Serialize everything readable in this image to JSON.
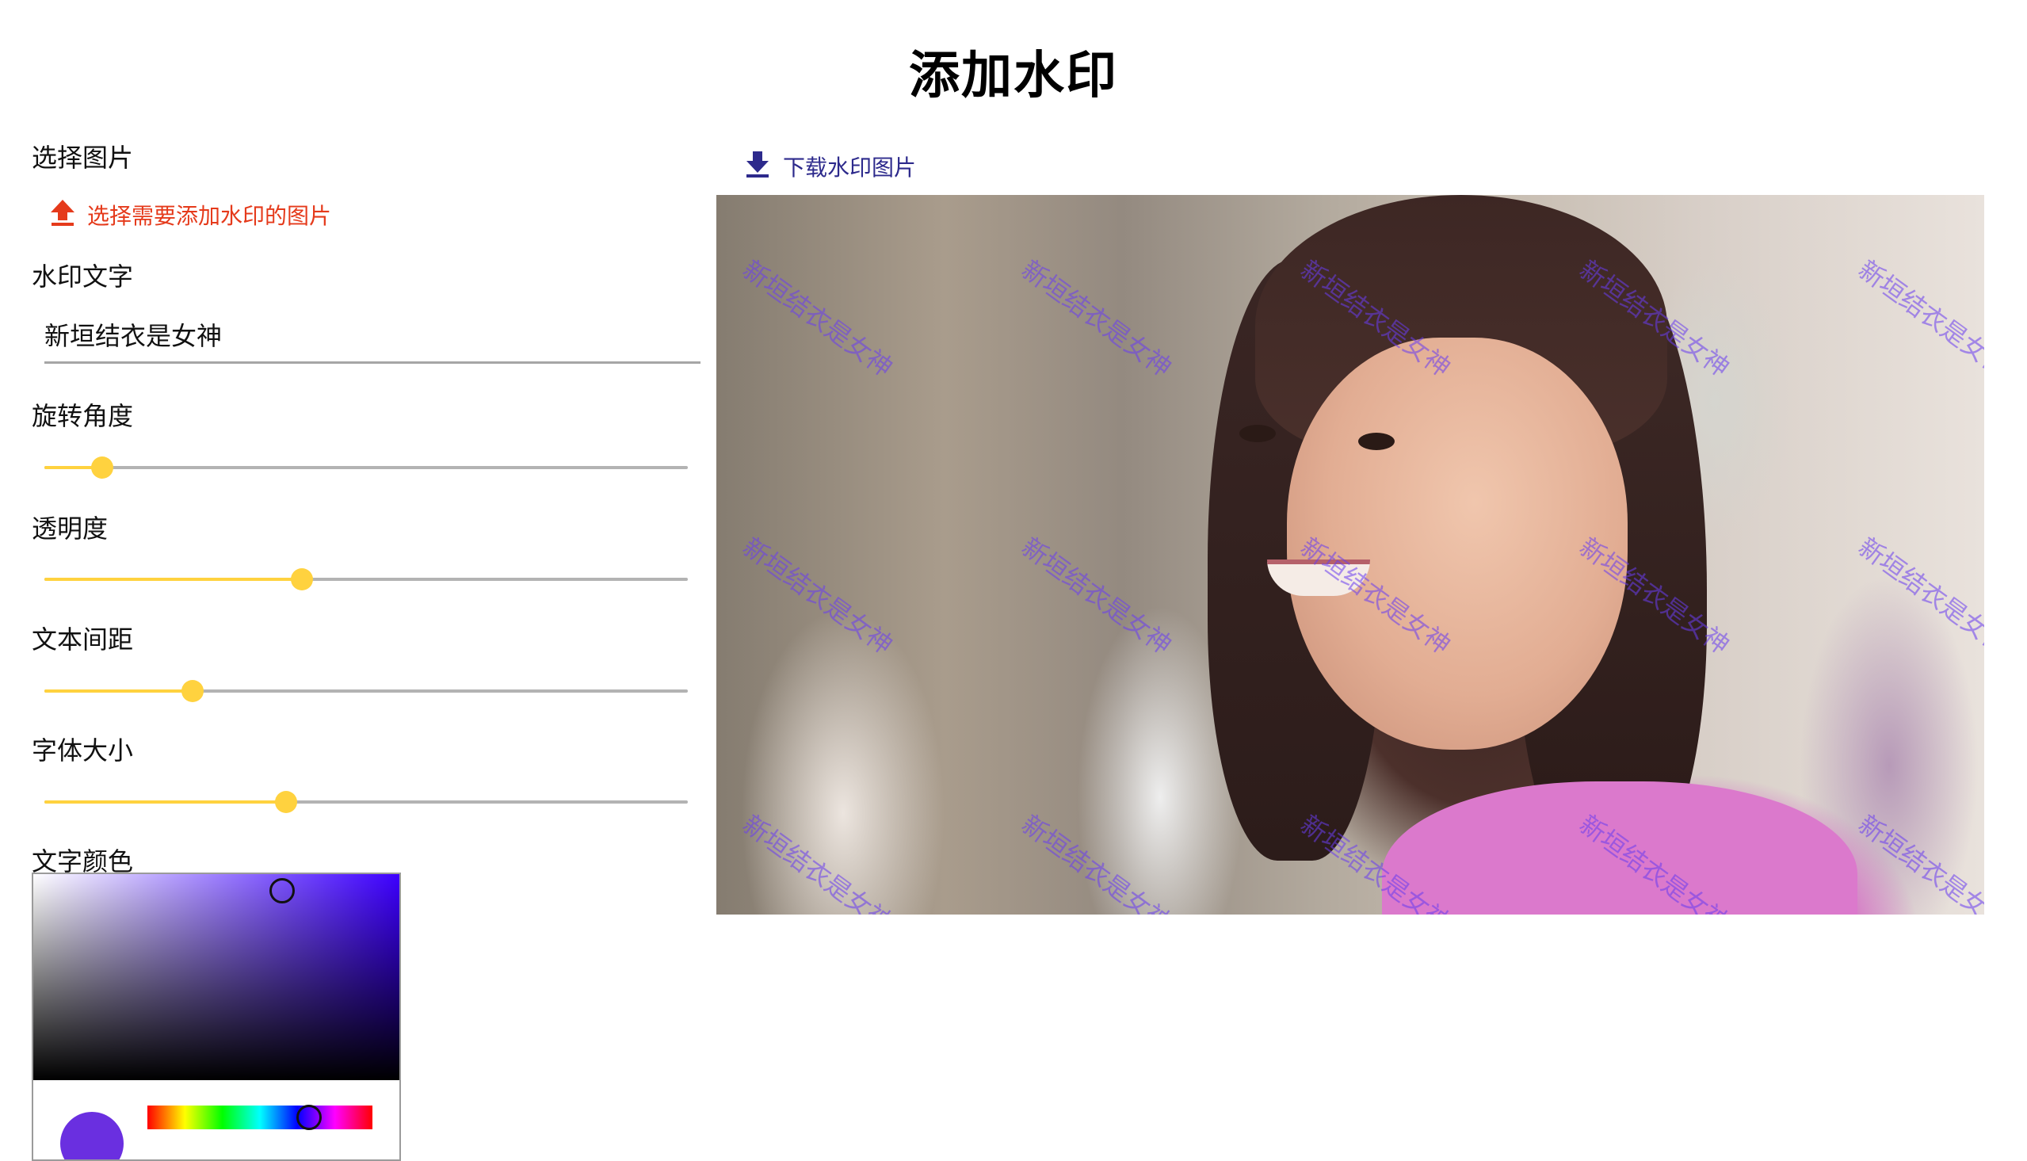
{
  "page": {
    "title": "添加水印"
  },
  "controls": {
    "select_image": {
      "label": "选择图片",
      "button_label": "选择需要添加水印的图片",
      "icon": "upload-icon",
      "color": "#e53a1b"
    },
    "watermark_text": {
      "label": "水印文字",
      "value": "新垣结衣是女神"
    },
    "rotation": {
      "label": "旋转角度",
      "value": 0.09
    },
    "opacity": {
      "label": "透明度",
      "value": 0.4
    },
    "spacing": {
      "label": "文本间距",
      "value": 0.23
    },
    "font_size": {
      "label": "字体大小",
      "value": 0.375
    },
    "text_color": {
      "label": "文字颜色",
      "value": "#6a2fe0",
      "picker_hue_color": "#3d00ff",
      "saturation": 0.68,
      "brightness": 0.92,
      "hue_position": 0.72
    }
  },
  "preview": {
    "download_label": "下载水印图片",
    "download_icon": "download-icon",
    "download_color": "#2d2a8c",
    "watermark_color": "#6a3df0"
  },
  "colors": {
    "slider_accent": "#ffd23f",
    "slider_track": "#b3b3b3"
  }
}
